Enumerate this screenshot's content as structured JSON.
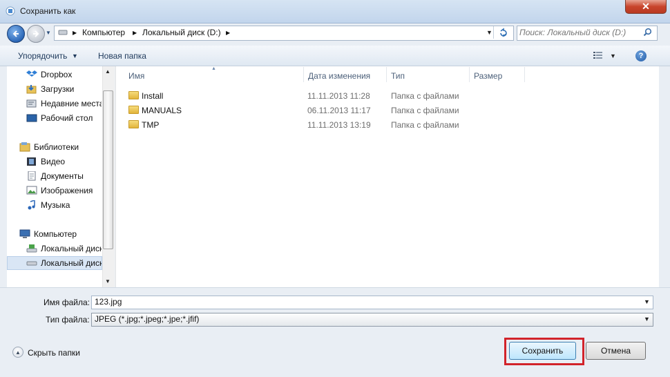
{
  "window": {
    "title": "Сохранить как",
    "close_label": "✕"
  },
  "address": {
    "crumbs": [
      "Компьютер",
      "Локальный диск (D:)"
    ]
  },
  "search": {
    "placeholder": "Поиск: Локальный диск (D:)"
  },
  "toolbar": {
    "organize_label": "Упорядочить",
    "new_folder_label": "Новая папка"
  },
  "sidebar": {
    "items": [
      {
        "label": "Dropbox",
        "icon": "dropbox-icon"
      },
      {
        "label": "Загрузки",
        "icon": "downloads-icon"
      },
      {
        "label": "Недавние места",
        "icon": "recent-places-icon"
      },
      {
        "label": "Рабочий стол",
        "icon": "desktop-icon"
      },
      {
        "label": "Библиотеки",
        "icon": "libraries-icon"
      },
      {
        "label": "Видео",
        "icon": "video-icon"
      },
      {
        "label": "Документы",
        "icon": "documents-icon"
      },
      {
        "label": "Изображения",
        "icon": "pictures-icon"
      },
      {
        "label": "Музыка",
        "icon": "music-icon"
      },
      {
        "label": "Компьютер",
        "icon": "computer-icon"
      },
      {
        "label": "Локальный диск",
        "icon": "local-disk-icon"
      },
      {
        "label": "Локальный диск",
        "icon": "local-disk-icon"
      }
    ]
  },
  "columns": {
    "name": "Имя",
    "date": "Дата изменения",
    "type": "Тип",
    "size": "Размер"
  },
  "files": [
    {
      "name": "Install",
      "date": "11.11.2013 11:28",
      "type": "Папка с файлами"
    },
    {
      "name": "MANUALS",
      "date": "06.11.2013 11:17",
      "type": "Папка с файлами"
    },
    {
      "name": "TMP",
      "date": "11.11.2013 13:19",
      "type": "Папка с файлами"
    }
  ],
  "form": {
    "filename_label": "Имя файла:",
    "filename_value": "123.jpg",
    "filetype_label": "Тип файла:",
    "filetype_value": "JPEG (*.jpg;*.jpeg;*.jpe;*.jfif)"
  },
  "footer": {
    "hide_folders_label": "Скрыть папки",
    "save_label": "Сохранить",
    "cancel_label": "Отмена"
  },
  "colors": {
    "highlight": "#d2232a",
    "accent": "#3c7fb1"
  }
}
